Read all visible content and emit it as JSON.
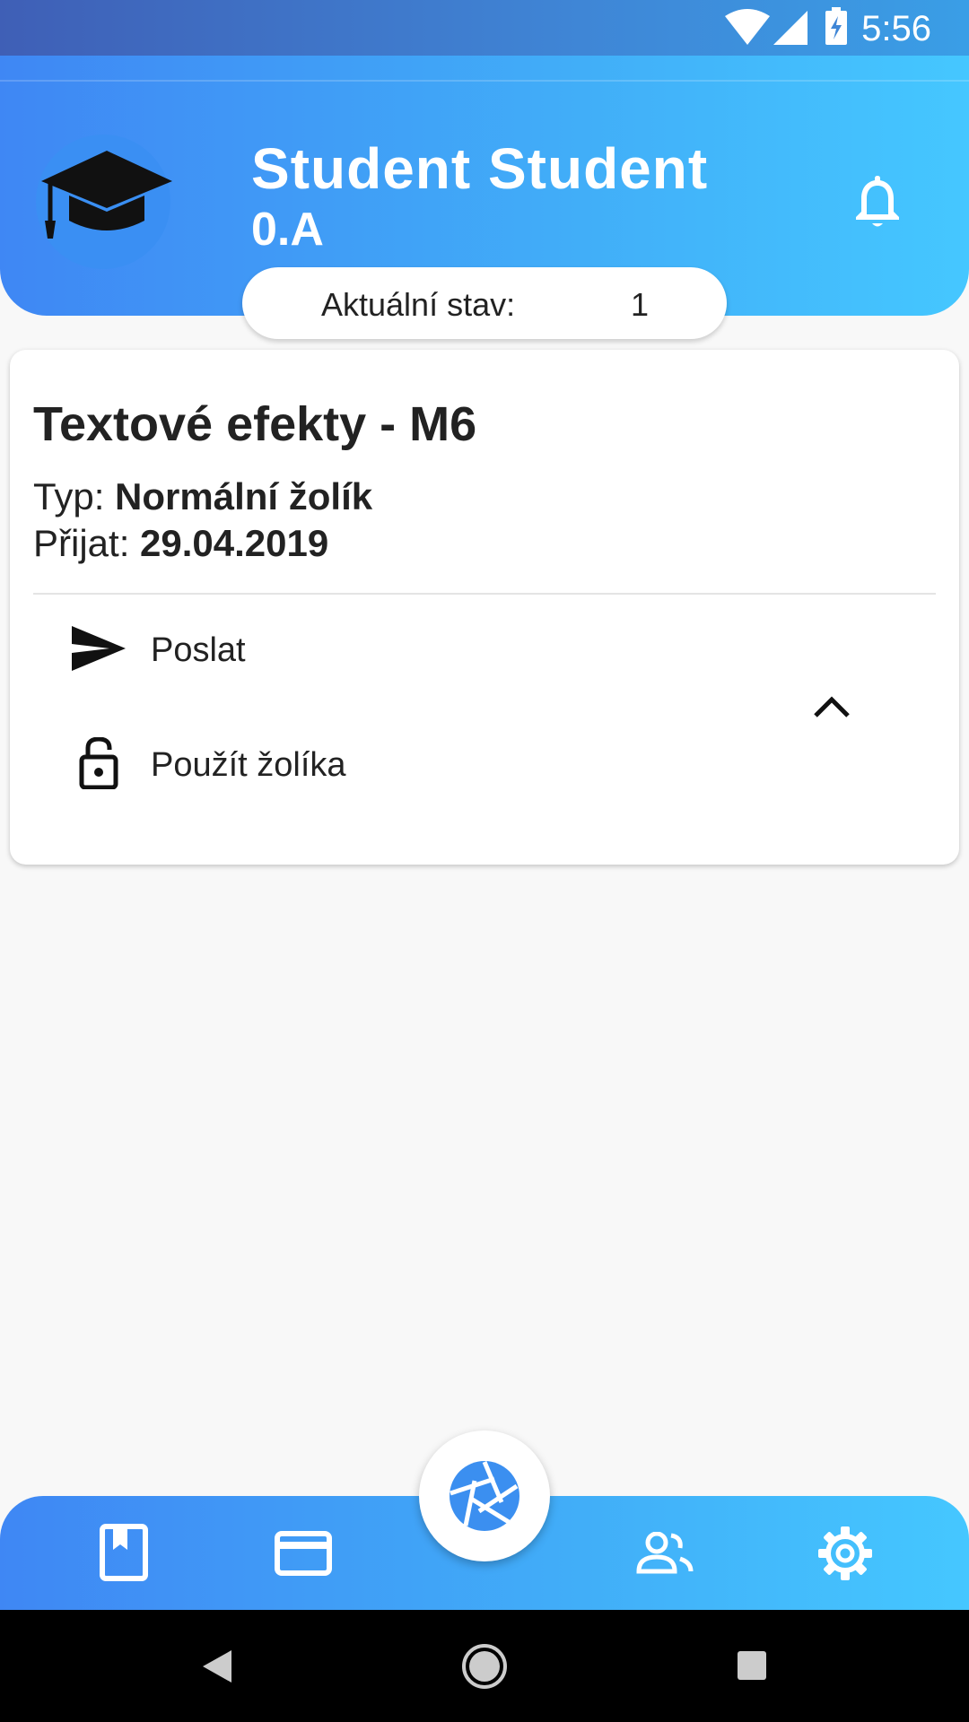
{
  "status_bar": {
    "time": "5:56"
  },
  "header": {
    "name": "Student Student",
    "class": "0.A",
    "state_label": "Aktuální stav:",
    "state_value": "1"
  },
  "card": {
    "title": "Textové efekty - M6",
    "type_label": "Typ:",
    "type_value": "Normální žolík",
    "received_label": "Přijat:",
    "received_value": "29.04.2019",
    "actions": [
      {
        "label": "Poslat",
        "icon": "send-icon"
      },
      {
        "label": "Použít žolíka",
        "icon": "lock-open-icon"
      }
    ]
  },
  "bottom_nav": {
    "items": [
      "book-icon",
      "card-icon",
      "camera-aperture-icon",
      "people-icon",
      "settings-icon"
    ]
  },
  "colors": {
    "accent": "#41aef8",
    "accent_start": "#3f87f4",
    "accent_end": "#45c7ff"
  }
}
